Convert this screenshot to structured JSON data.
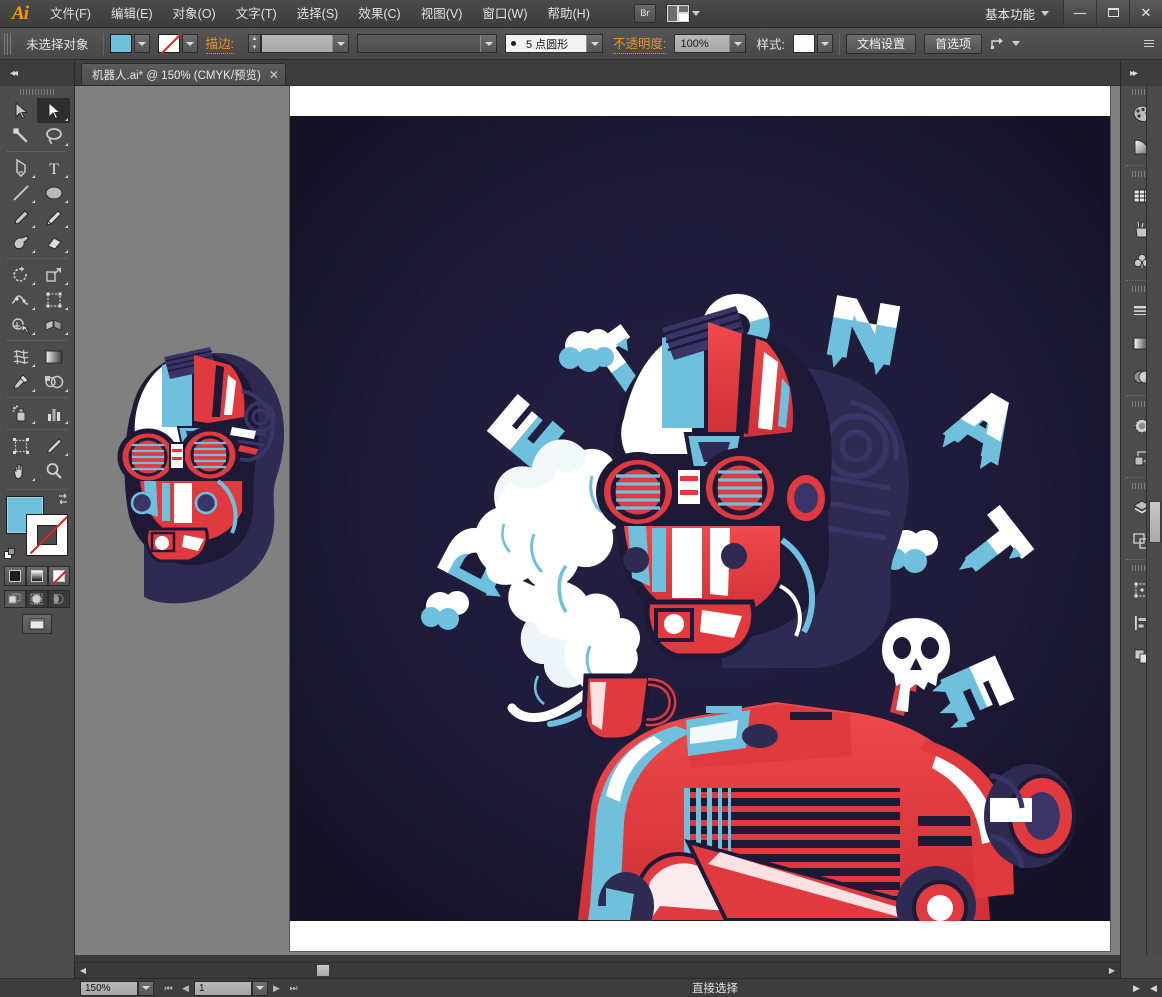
{
  "app": {
    "name": "Adobe Illustrator",
    "logo": "Ai"
  },
  "menubar": {
    "items": [
      {
        "label": "文件(F)",
        "name": "menu-file"
      },
      {
        "label": "编辑(E)",
        "name": "menu-edit"
      },
      {
        "label": "对象(O)",
        "name": "menu-object"
      },
      {
        "label": "文字(T)",
        "name": "menu-type"
      },
      {
        "label": "选择(S)",
        "name": "menu-select"
      },
      {
        "label": "效果(C)",
        "name": "menu-effect"
      },
      {
        "label": "视图(V)",
        "name": "menu-view"
      },
      {
        "label": "窗口(W)",
        "name": "menu-window"
      },
      {
        "label": "帮助(H)",
        "name": "menu-help"
      }
    ],
    "bridge_label": "Br",
    "workspace": "基本功能",
    "window_minimize": "—",
    "window_restore": "❐",
    "window_close": "✕"
  },
  "optionsbar": {
    "selection_status": "未选择对象",
    "fill_color": "#6fc0dd",
    "stroke_label": "描边:",
    "stroke_weight": "",
    "stroke_profile": "",
    "brush_definition": "5 点圆形",
    "opacity_label": "不透明度:",
    "opacity_value": "100%",
    "style_label": "样式:",
    "document_setup_button": "文档设置",
    "preferences_button": "首选项",
    "accent_orange": "#e8912c"
  },
  "tabs": {
    "documents": [
      {
        "title": "机器人.ai* @ 150% (CMYK/预览)",
        "close": "✕",
        "active": true
      }
    ]
  },
  "toolbar": {
    "tools": [
      {
        "name": "selection-tool",
        "label": "选择工具",
        "selected": false
      },
      {
        "name": "direct-selection-tool",
        "label": "直接选择工具",
        "selected": true
      },
      {
        "name": "magic-wand-tool",
        "label": "魔棒工具",
        "selected": false
      },
      {
        "name": "lasso-tool",
        "label": "套索工具",
        "selected": false
      },
      {
        "name": "pen-tool",
        "label": "钢笔工具",
        "selected": false
      },
      {
        "name": "type-tool",
        "label": "文字工具",
        "selected": false
      },
      {
        "name": "line-segment-tool",
        "label": "直线段工具",
        "selected": false
      },
      {
        "name": "ellipse-tool",
        "label": "椭圆工具",
        "selected": false
      },
      {
        "name": "paintbrush-tool",
        "label": "画笔工具",
        "selected": false
      },
      {
        "name": "pencil-tool",
        "label": "铅笔工具",
        "selected": false
      },
      {
        "name": "blob-brush-tool",
        "label": "斑点画笔工具",
        "selected": false
      },
      {
        "name": "eraser-tool",
        "label": "橡皮擦工具",
        "selected": false
      },
      {
        "name": "rotate-tool",
        "label": "旋转工具",
        "selected": false
      },
      {
        "name": "scale-tool",
        "label": "比例缩放工具",
        "selected": false
      },
      {
        "name": "width-tool",
        "label": "宽度工具",
        "selected": false
      },
      {
        "name": "free-transform-tool",
        "label": "自由变换工具",
        "selected": false
      },
      {
        "name": "shape-builder-tool",
        "label": "形状生成器工具",
        "selected": false
      },
      {
        "name": "perspective-grid-tool",
        "label": "透视网格工具",
        "selected": false
      },
      {
        "name": "mesh-tool",
        "label": "网格工具",
        "selected": false
      },
      {
        "name": "gradient-tool",
        "label": "渐变工具",
        "selected": false
      },
      {
        "name": "eyedropper-tool",
        "label": "吸管工具",
        "selected": false
      },
      {
        "name": "blend-tool",
        "label": "混合工具",
        "selected": false
      },
      {
        "name": "symbol-sprayer-tool",
        "label": "符号喷枪工具",
        "selected": false
      },
      {
        "name": "column-graph-tool",
        "label": "柱形图工具",
        "selected": false
      },
      {
        "name": "artboard-tool",
        "label": "画板工具",
        "selected": false
      },
      {
        "name": "slice-tool",
        "label": "切片工具",
        "selected": false
      },
      {
        "name": "hand-tool",
        "label": "抓手工具",
        "selected": false
      },
      {
        "name": "zoom-tool",
        "label": "缩放工具",
        "selected": false
      }
    ],
    "fill_color": "#6fc0dd",
    "stroke_color": "#ffffff",
    "color_modes": [
      {
        "name": "color-mode-button",
        "label": "颜色"
      },
      {
        "name": "gradient-mode-button",
        "label": "渐变"
      },
      {
        "name": "none-mode-button",
        "label": "无"
      }
    ],
    "draw_modes": [
      {
        "name": "draw-normal-button",
        "label": "正常绘图"
      },
      {
        "name": "draw-behind-button",
        "label": "背面绘图"
      },
      {
        "name": "draw-inside-button",
        "label": "内部绘图"
      }
    ],
    "screen_mode": {
      "name": "screen-mode-button",
      "label": "更改屏幕模式"
    }
  },
  "rightdock": {
    "groups": [
      {
        "items": [
          {
            "name": "color-panel-icon",
            "label": "颜色"
          },
          {
            "name": "color-guide-panel-icon",
            "label": "颜色参考"
          }
        ]
      },
      {
        "items": [
          {
            "name": "swatches-panel-icon",
            "label": "色板"
          },
          {
            "name": "brushes-panel-icon",
            "label": "画笔"
          },
          {
            "name": "symbols-panel-icon",
            "label": "符号"
          }
        ]
      },
      {
        "items": [
          {
            "name": "stroke-panel-icon",
            "label": "描边"
          },
          {
            "name": "gradient-panel-icon",
            "label": "渐变"
          },
          {
            "name": "transparency-panel-icon",
            "label": "透明度"
          }
        ]
      },
      {
        "items": [
          {
            "name": "appearance-panel-icon",
            "label": "外观"
          },
          {
            "name": "graphic-styles-panel-icon",
            "label": "图形样式"
          }
        ]
      },
      {
        "items": [
          {
            "name": "layers-panel-icon",
            "label": "图层"
          },
          {
            "name": "artboards-panel-icon",
            "label": "画板"
          }
        ]
      },
      {
        "items": [
          {
            "name": "transform-panel-icon",
            "label": "变换"
          },
          {
            "name": "align-panel-icon",
            "label": "对齐"
          },
          {
            "name": "pathfinder-panel-icon",
            "label": "路径查找器"
          }
        ]
      }
    ]
  },
  "artwork": {
    "title": "DETONATE",
    "letters": [
      "D",
      "E",
      "T",
      "O",
      "N",
      "A",
      "T",
      "E"
    ],
    "background_color": "#1d1936",
    "palette": {
      "dark_navy": "#1d1936",
      "deep_purple": "#2e2a52",
      "red": "#e03a3e",
      "light_blue": "#6fc0dd",
      "white": "#ffffff",
      "shadow_blue": "#3a3566"
    },
    "artboard_color": "#ffffff",
    "canvas_color": "#808080"
  },
  "statusbar": {
    "zoom_value": "150%",
    "page_value": "1",
    "status_text": "直接选择",
    "nav_first": "⏮",
    "nav_prev": "◀",
    "nav_next": "▶",
    "nav_last": "⏭"
  }
}
